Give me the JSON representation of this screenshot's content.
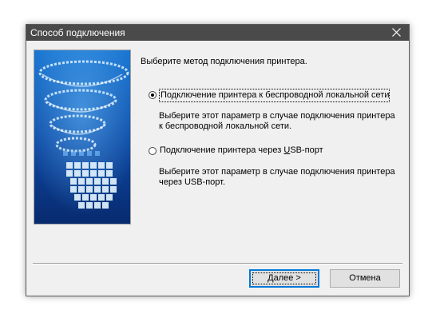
{
  "window": {
    "title": "Способ подключения",
    "close_glyph": "close-icon"
  },
  "content": {
    "prompt": "Выберите метод подключения принтера.",
    "options": [
      {
        "label": "Подключение принтера к беспроводной локальной сети",
        "description_line1": "Выберите этот параметр в случае подключения принтера",
        "description_line2": "к беспроводной локальной сети.",
        "selected": true
      },
      {
        "label_before": "Подключение принтера через ",
        "label_mnemonic": "U",
        "label_after": "SB-порт",
        "description_line1": "Выберите этот параметр в случае подключения принтера",
        "description_line2": "через USB-порт.",
        "selected": false
      }
    ]
  },
  "buttons": {
    "next_mnemonic": "Д",
    "next_rest": "алее >",
    "cancel": "Отмена"
  },
  "colors": {
    "titlebar": "#4a4a4a",
    "banner_top": "#1565c0",
    "banner_bottom": "#0a2f7a",
    "default_button_border": "#0078d7"
  }
}
